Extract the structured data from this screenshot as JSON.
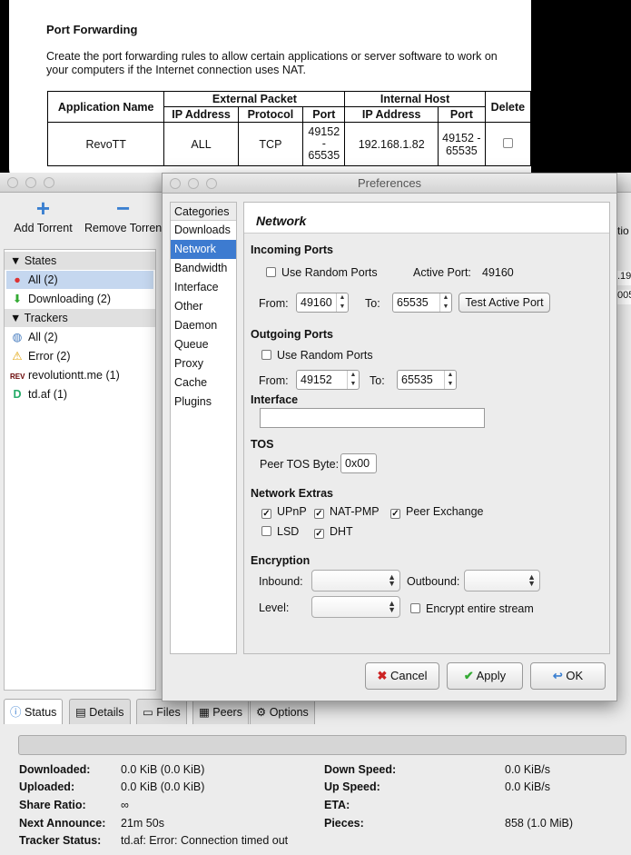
{
  "router": {
    "title": "Port Forwarding",
    "description": "Create the port forwarding rules to allow certain applications or server software to work on your computers if the Internet connection uses NAT.",
    "table": {
      "col_app": "Application Name",
      "col_external": "External Packet",
      "col_internal": "Internal Host",
      "col_delete": "Delete",
      "sub_ip": "IP Address",
      "sub_protocol": "Protocol",
      "sub_port": "Port",
      "sub_ip2": "IP Address",
      "sub_port2": "Port",
      "row": {
        "app": "RevoTT",
        "ext_ip": "ALL",
        "protocol": "TCP",
        "ext_port_a": "49152",
        "ext_port_dash": "-",
        "ext_port_b": "65535",
        "int_ip": "192.168.1.82",
        "int_port_a": "49152 -",
        "int_port_b": "65535"
      }
    }
  },
  "deluge": {
    "toolbar": {
      "add_torrent": "Add Torrent",
      "remove_torrent": "Remove Torrent",
      "add_icon": "+",
      "remove_icon": "−"
    },
    "sidebar": {
      "states_header": "States",
      "states": [
        "All (2)",
        "Downloading (2)"
      ],
      "trackers_header": "Trackers",
      "trackers": [
        "All (2)",
        "Error (2)",
        "revolutiontt.me (1)",
        "td.af (1)"
      ]
    },
    "tabs": [
      "Status",
      "Details",
      "Files",
      "Peers",
      "Options"
    ],
    "status": {
      "downloaded_label": "Downloaded:",
      "downloaded": "0.0 KiB (0.0 KiB)",
      "uploaded_label": "Uploaded:",
      "uploaded": "0.0 KiB (0.0 KiB)",
      "share_ratio_label": "Share Ratio:",
      "share_ratio": "∞",
      "next_announce_label": "Next Announce:",
      "next_announce": "21m 50s",
      "tracker_status_label": "Tracker Status:",
      "tracker_status": "td.af: Error: Connection timed out",
      "down_speed_label": "Down Speed:",
      "down_speed": "0.0 KiB/s",
      "up_speed_label": "Up Speed:",
      "up_speed": "0.0 KiB/s",
      "eta_label": "ETA:",
      "eta": "",
      "pieces_label": "Pieces:",
      "pieces": "858 (1.0 MiB)"
    },
    "peek": [
      ".19",
      "005",
      "tio"
    ]
  },
  "prefs": {
    "title": "Preferences",
    "categories_header": "Categories",
    "categories": [
      "Downloads",
      "Network",
      "Bandwidth",
      "Interface",
      "Other",
      "Daemon",
      "Queue",
      "Proxy",
      "Cache",
      "Plugins"
    ],
    "selected_category": "Network",
    "pane_title": "Network",
    "incoming": {
      "header": "Incoming Ports",
      "random_label": "Use Random Ports",
      "active_port_label": "Active Port:",
      "active_port": "49160",
      "from_label": "From:",
      "from": "49160",
      "to_label": "To:",
      "to": "65535",
      "test_button": "Test Active Port"
    },
    "outgoing": {
      "header": "Outgoing Ports",
      "random_label": "Use Random Ports",
      "from_label": "From:",
      "from": "49152",
      "to_label": "To:",
      "to": "65535"
    },
    "interface": {
      "header": "Interface",
      "value": ""
    },
    "tos": {
      "header": "TOS",
      "label": "Peer TOS Byte:",
      "value": "0x00"
    },
    "extras": {
      "header": "Network Extras",
      "upnp": "UPnP",
      "natpmp": "NAT-PMP",
      "pex": "Peer Exchange",
      "lsd": "LSD",
      "dht": "DHT"
    },
    "encryption": {
      "header": "Encryption",
      "inbound_label": "Inbound:",
      "outbound_label": "Outbound:",
      "level_label": "Level:",
      "encrypt_label": "Encrypt entire stream"
    },
    "buttons": {
      "cancel": "Cancel",
      "apply": "Apply",
      "ok": "OK"
    }
  }
}
